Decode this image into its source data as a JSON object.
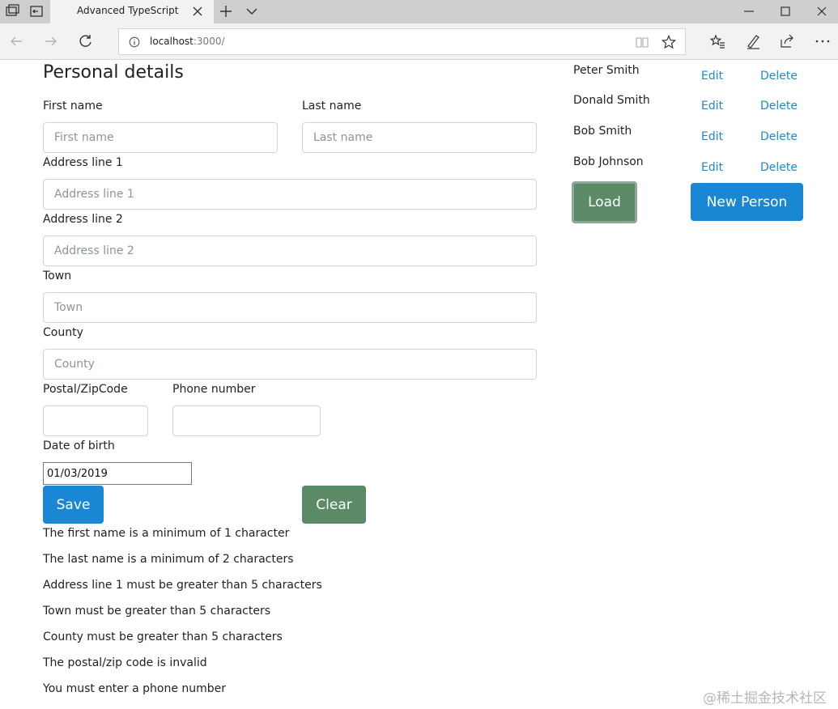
{
  "browser": {
    "tab_title": "Advanced TypeScript",
    "url_host": "localhost",
    "url_rest": ":3000/"
  },
  "form": {
    "heading": "Personal details",
    "first_name": {
      "label": "First name",
      "placeholder": "First name",
      "value": ""
    },
    "last_name": {
      "label": "Last name",
      "placeholder": "Last name",
      "value": ""
    },
    "address1": {
      "label": "Address line 1",
      "placeholder": "Address line 1",
      "value": ""
    },
    "address2": {
      "label": "Address line 2",
      "placeholder": "Address line 2",
      "value": ""
    },
    "town": {
      "label": "Town",
      "placeholder": "Town",
      "value": ""
    },
    "county": {
      "label": "County",
      "placeholder": "County",
      "value": ""
    },
    "postal": {
      "label": "Postal/ZipCode",
      "value": ""
    },
    "phone": {
      "label": "Phone number",
      "value": ""
    },
    "dob": {
      "label": "Date of birth",
      "value": "01/03/2019"
    },
    "save_label": "Save",
    "clear_label": "Clear"
  },
  "validation_errors": [
    "The first name is a minimum of 1 character",
    "The last name is a minimum of 2 characters",
    "Address line 1 must be greater than 5 characters",
    "Town must be greater than 5 characters",
    "County must be greater than 5 characters",
    "The postal/zip code is invalid",
    "You must enter a phone number"
  ],
  "people": {
    "items": [
      {
        "name": "Peter Smith",
        "edit": "Edit",
        "delete": "Delete"
      },
      {
        "name": "Donald Smith",
        "edit": "Edit",
        "delete": "Delete"
      },
      {
        "name": "Bob Smith",
        "edit": "Edit",
        "delete": "Delete"
      },
      {
        "name": "Bob Johnson",
        "edit": "Edit",
        "delete": "Delete"
      }
    ],
    "load_label": "Load",
    "new_person_label": "New Person"
  },
  "watermark": "@稀土掘金技术社区",
  "colors": {
    "primary": "#1a87d4",
    "secondary_green": "#5a8a66",
    "link": "#2389c8"
  }
}
